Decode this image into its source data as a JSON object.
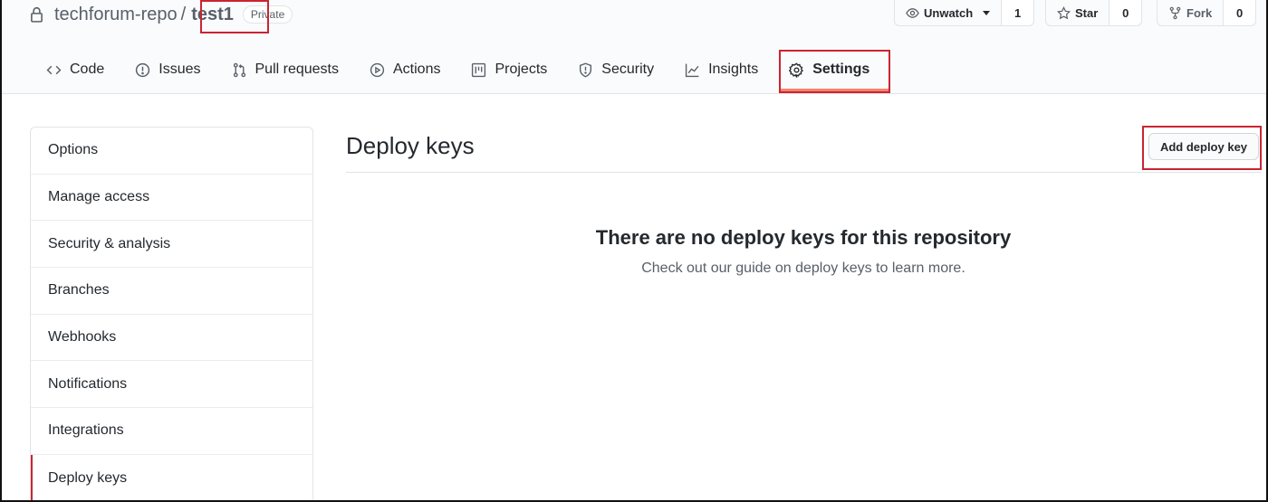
{
  "repo": {
    "owner": "techforum-repo",
    "separator": "/",
    "name": "test1",
    "visibility": "Private"
  },
  "actions": {
    "watch": {
      "label": "Unwatch",
      "count": "1"
    },
    "star": {
      "label": "Star",
      "count": "0"
    },
    "fork": {
      "label": "Fork",
      "count": "0"
    }
  },
  "tabs": [
    {
      "label": "Code",
      "icon": "code-icon"
    },
    {
      "label": "Issues",
      "icon": "issue-icon"
    },
    {
      "label": "Pull requests",
      "icon": "pull-request-icon"
    },
    {
      "label": "Actions",
      "icon": "play-icon"
    },
    {
      "label": "Projects",
      "icon": "project-icon"
    },
    {
      "label": "Security",
      "icon": "shield-icon"
    },
    {
      "label": "Insights",
      "icon": "graph-icon"
    },
    {
      "label": "Settings",
      "icon": "gear-icon",
      "selected": true
    }
  ],
  "sidebar": {
    "items": [
      {
        "label": "Options"
      },
      {
        "label": "Manage access"
      },
      {
        "label": "Security & analysis"
      },
      {
        "label": "Branches"
      },
      {
        "label": "Webhooks"
      },
      {
        "label": "Notifications"
      },
      {
        "label": "Integrations"
      },
      {
        "label": "Deploy keys",
        "active": true
      }
    ]
  },
  "main": {
    "title": "Deploy keys",
    "add_button": "Add deploy key",
    "blankslate_title": "There are no deploy keys for this repository",
    "blankslate_text": "Check out our guide on deploy keys to learn more."
  },
  "colors": {
    "highlight": "#cb2431",
    "tab_underline": "#f9826c",
    "text": "#24292e",
    "muted": "#586069"
  }
}
